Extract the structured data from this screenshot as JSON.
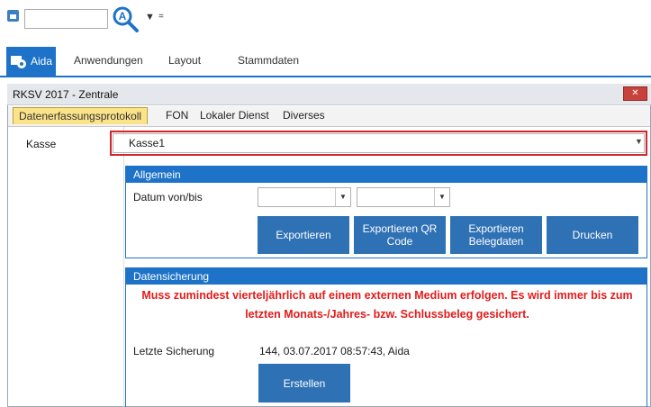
{
  "quick_access": {
    "search_icon": "search-magnifier-icon",
    "dropdown_glyph": "▼",
    "more_glyph": "="
  },
  "ribbon": {
    "tabs": [
      {
        "label": "Aida"
      },
      {
        "label": "Anwendungen"
      },
      {
        "label": "Layout"
      },
      {
        "label": "Stammdaten"
      }
    ]
  },
  "window": {
    "title": "RKSV 2017 - Zentrale",
    "close_glyph": "✕",
    "tabs": [
      {
        "label": "Datenerfassungsprotokoll",
        "active": true
      },
      {
        "label": "FON"
      },
      {
        "label": "Lokaler Dienst"
      },
      {
        "label": "Diverses"
      }
    ]
  },
  "form": {
    "kasse_label": "Kasse",
    "kasse_value": "Kasse1"
  },
  "allgemein": {
    "header": "Allgemein",
    "datum_label": "Datum von/bis",
    "buttons": [
      {
        "label": "Exportieren"
      },
      {
        "label": "Exportieren QR Code"
      },
      {
        "label": "Exportieren Belegdaten"
      },
      {
        "label": "Drucken"
      }
    ]
  },
  "datensicherung": {
    "header": "Datensicherung",
    "warning": "Muss zumindest vierteljährlich auf einem externen Medium erfolgen. Es wird immer bis zum letzten Monats-/Jahres- bzw. Schlussbeleg gesichert.",
    "letzte_label": "Letzte Sicherung",
    "letzte_value": "144, 03.07.2017 08:57:43, Aida",
    "button": "Erstellen"
  },
  "colors": {
    "accent_blue": "#1e73c8",
    "button_blue": "#2f71b5",
    "warning_red": "#e21b1b",
    "active_tab": "#fbe38a"
  }
}
